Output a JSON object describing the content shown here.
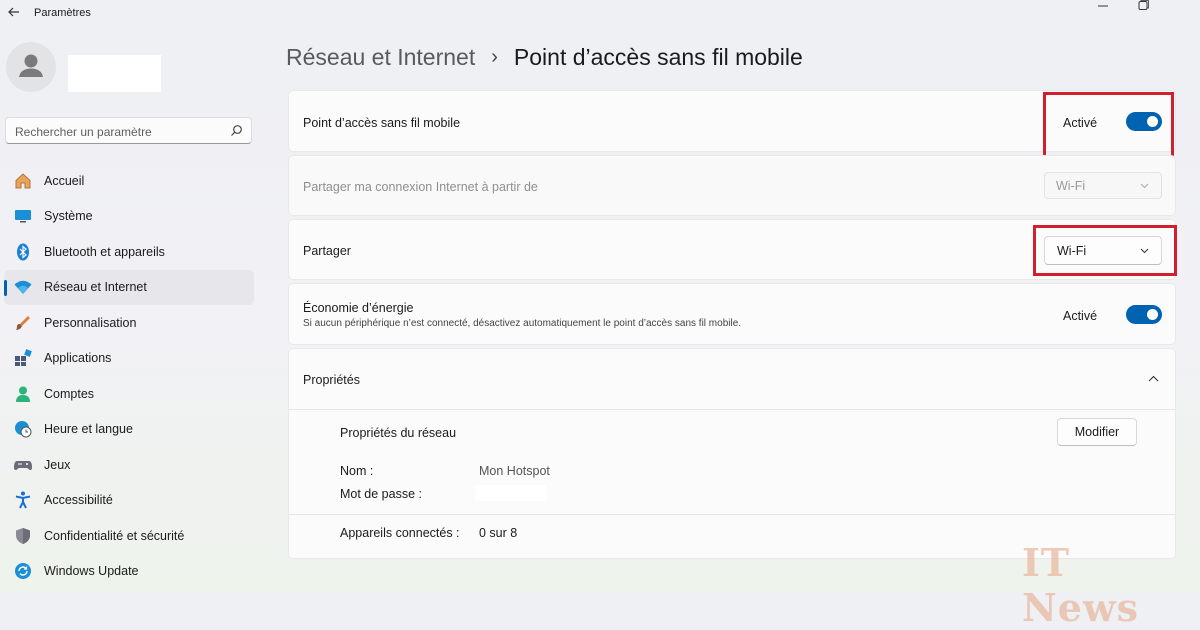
{
  "window": {
    "title": "Paramètres"
  },
  "search": {
    "placeholder": "Rechercher un paramètre"
  },
  "sidebar": {
    "items": [
      {
        "label": "Accueil",
        "icon": "home-icon"
      },
      {
        "label": "Système",
        "icon": "system-icon"
      },
      {
        "label": "Bluetooth et appareils",
        "icon": "bluetooth-icon"
      },
      {
        "label": "Réseau et Internet",
        "icon": "wifi-icon",
        "selected": true
      },
      {
        "label": "Personnalisation",
        "icon": "brush-icon"
      },
      {
        "label": "Applications",
        "icon": "apps-icon"
      },
      {
        "label": "Comptes",
        "icon": "account-icon"
      },
      {
        "label": "Heure et langue",
        "icon": "globe-clock-icon"
      },
      {
        "label": "Jeux",
        "icon": "gamepad-icon"
      },
      {
        "label": "Accessibilité",
        "icon": "accessibility-icon"
      },
      {
        "label": "Confidentialité et sécurité",
        "icon": "shield-icon"
      },
      {
        "label": "Windows Update",
        "icon": "update-icon"
      }
    ]
  },
  "breadcrumb": {
    "parent": "Réseau et Internet",
    "separator": "›",
    "current": "Point d’accès sans fil mobile"
  },
  "hotspot": {
    "label": "Point d’accès sans fil mobile",
    "state": "Activé",
    "on": true
  },
  "share_from": {
    "label": "Partager ma connexion Internet à partir de",
    "value": "Wi-Fi",
    "disabled": true
  },
  "share": {
    "label": "Partager",
    "value": "Wi-Fi"
  },
  "power_saving": {
    "label": "Économie d’énergie",
    "description": "Si aucun périphérique n’est connecté, désactivez automatiquement le point d’accès sans fil mobile.",
    "state": "Activé",
    "on": true
  },
  "properties": {
    "title": "Propriétés",
    "network_title": "Propriétés du réseau",
    "edit_button": "Modifier",
    "name_label": "Nom :",
    "name_value": "Mon Hotspot",
    "password_label": "Mot de passe :",
    "devices_label": "Appareils connectés :",
    "devices_value": "0 sur 8"
  },
  "watermark": "IT News",
  "colors": {
    "accent": "#0063b1",
    "highlight_box": "#d01f2f"
  }
}
